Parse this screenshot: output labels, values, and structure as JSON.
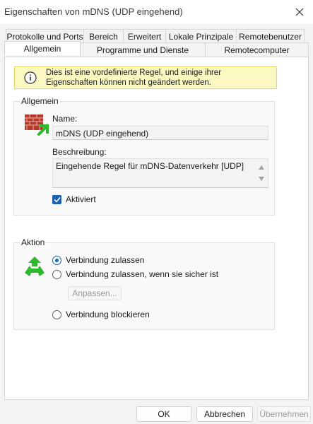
{
  "window": {
    "title": "Eigenschaften von mDNS (UDP eingehend)"
  },
  "tabs": {
    "back": [
      "Protokolle und Ports",
      "Bereich",
      "Erweitert",
      "Lokale Prinzipale",
      "Remotebenutzer"
    ],
    "front": [
      "Allgemein",
      "Programme und Dienste",
      "Remotecomputer"
    ],
    "active": "Allgemein"
  },
  "info": {
    "text_line1": "Dies ist eine vordefinierte Regel, und einige ihrer",
    "text_line2": "Eigenschaften können nicht geändert werden."
  },
  "general": {
    "legend": "Allgemein",
    "name_label": "Name:",
    "name_value": "mDNS (UDP eingehend)",
    "description_label": "Beschreibung:",
    "description_value": "Eingehende Regel für mDNS-Datenverkehr [UDP]",
    "enabled_label": "Aktiviert",
    "enabled": true
  },
  "action": {
    "legend": "Aktion",
    "options": [
      "Verbindung zulassen",
      "Verbindung zulassen, wenn sie sicher ist",
      "Verbindung blockieren"
    ],
    "selected": "Verbindung zulassen",
    "customize_button": "Anpassen..."
  },
  "footer": {
    "ok": "OK",
    "cancel": "Abbrechen",
    "apply": "Übernehmen"
  },
  "colors": {
    "accent": "#1a5fb4",
    "info_bg": "#fbf8c1",
    "icon_green": "#2db82d"
  }
}
